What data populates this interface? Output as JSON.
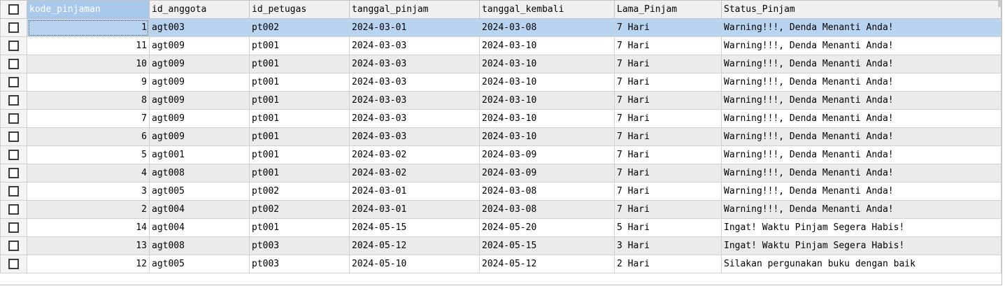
{
  "columns": [
    "kode_pinjaman",
    "id_anggota",
    "id_petugas",
    "tanggal_pinjam",
    "tanggal_kembali",
    "Lama_Pinjam",
    "Status_Pinjam"
  ],
  "rows": [
    [
      "1",
      "agt003",
      "pt002",
      "2024-03-01",
      "2024-03-08",
      "7 Hari",
      "Warning!!!, Denda Menanti Anda!"
    ],
    [
      "11",
      "agt009",
      "pt001",
      "2024-03-03",
      "2024-03-10",
      "7 Hari",
      "Warning!!!, Denda Menanti Anda!"
    ],
    [
      "10",
      "agt009",
      "pt001",
      "2024-03-03",
      "2024-03-10",
      "7 Hari",
      "Warning!!!, Denda Menanti Anda!"
    ],
    [
      "9",
      "agt009",
      "pt001",
      "2024-03-03",
      "2024-03-10",
      "7 Hari",
      "Warning!!!, Denda Menanti Anda!"
    ],
    [
      "8",
      "agt009",
      "pt001",
      "2024-03-03",
      "2024-03-10",
      "7 Hari",
      "Warning!!!, Denda Menanti Anda!"
    ],
    [
      "7",
      "agt009",
      "pt001",
      "2024-03-03",
      "2024-03-10",
      "7 Hari",
      "Warning!!!, Denda Menanti Anda!"
    ],
    [
      "6",
      "agt009",
      "pt001",
      "2024-03-03",
      "2024-03-10",
      "7 Hari",
      "Warning!!!, Denda Menanti Anda!"
    ],
    [
      "5",
      "agt001",
      "pt001",
      "2024-03-02",
      "2024-03-09",
      "7 Hari",
      "Warning!!!, Denda Menanti Anda!"
    ],
    [
      "4",
      "agt008",
      "pt001",
      "2024-03-02",
      "2024-03-09",
      "7 Hari",
      "Warning!!!, Denda Menanti Anda!"
    ],
    [
      "3",
      "agt005",
      "pt002",
      "2024-03-01",
      "2024-03-08",
      "7 Hari",
      "Warning!!!, Denda Menanti Anda!"
    ],
    [
      "2",
      "agt004",
      "pt002",
      "2024-03-01",
      "2024-03-08",
      "7 Hari",
      "Warning!!!, Denda Menanti Anda!"
    ],
    [
      "14",
      "agt004",
      "pt001",
      "2024-05-15",
      "2024-05-20",
      "5 Hari",
      "Ingat! Waktu Pinjam Segera Habis!"
    ],
    [
      "13",
      "agt008",
      "pt003",
      "2024-05-12",
      "2024-05-15",
      "3 Hari",
      "Ingat! Waktu Pinjam Segera Habis!"
    ],
    [
      "12",
      "agt005",
      "pt003",
      "2024-05-10",
      "2024-05-12",
      "2 Hari",
      "Silakan pergunakan buku dengan baik"
    ]
  ],
  "selected_row": 0,
  "selected_column": 0,
  "colors": {
    "selected_row": "#b9d4f0",
    "selected_header": "#a9c9ec",
    "alt_row": "#ebebeb"
  },
  "icons": {
    "row_checkbox": "checkbox-icon"
  }
}
